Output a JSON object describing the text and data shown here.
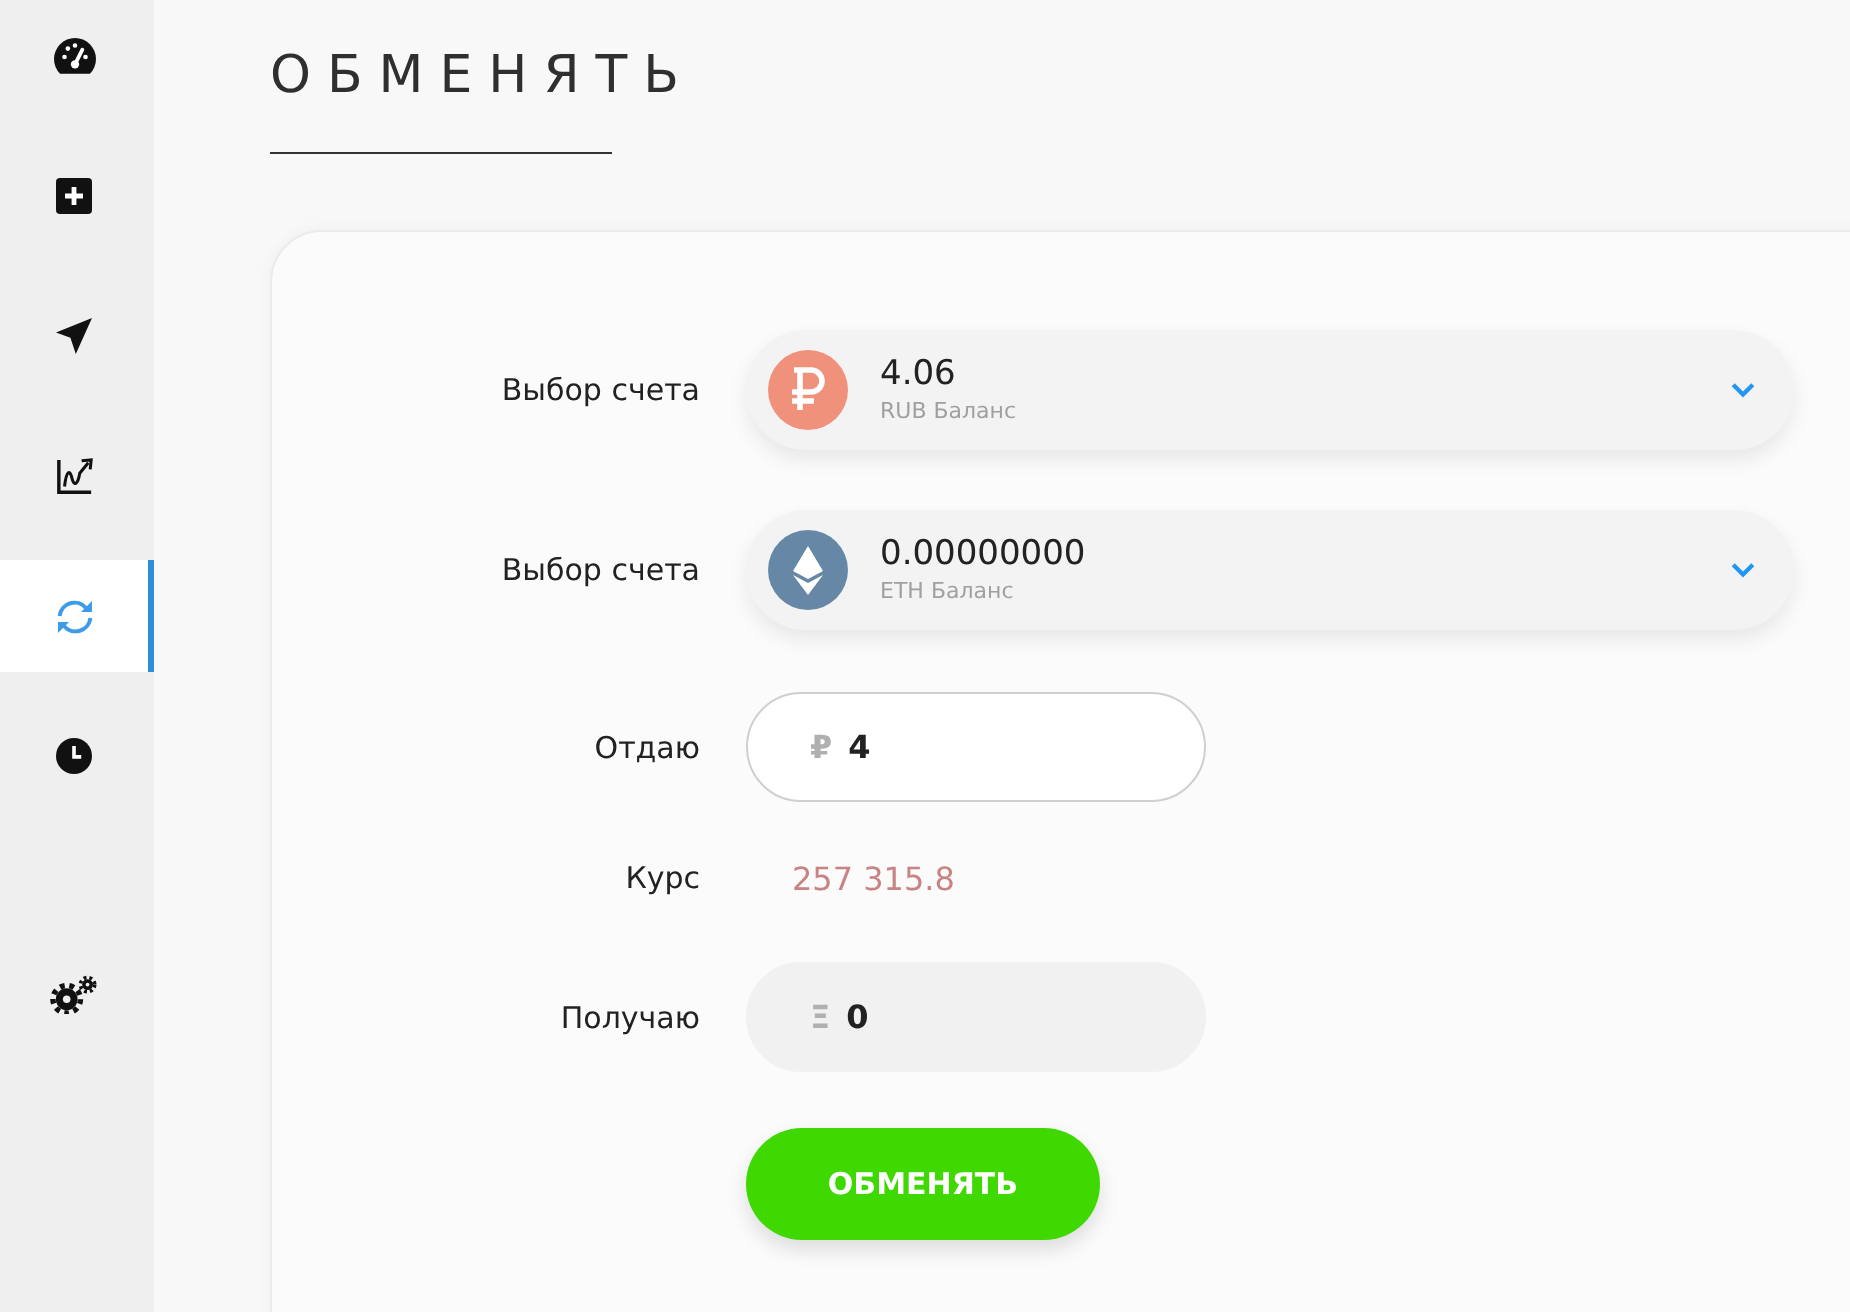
{
  "sidebar": {
    "items": [
      {
        "selected": false
      },
      {
        "selected": false
      },
      {
        "selected": false
      },
      {
        "selected": false
      },
      {
        "selected": true
      },
      {
        "selected": false
      }
    ],
    "bottom_items": [
      {
        "selected": false
      }
    ]
  },
  "page": {
    "title": "ОБМЕНЯТЬ"
  },
  "form": {
    "accounts": [
      {
        "label": "Выбор счета",
        "amount": "4.06",
        "caption": "RUB Баланс"
      },
      {
        "label": "Выбор счета",
        "amount": "0.00000000",
        "caption": "ETH Баланс"
      }
    ],
    "give": {
      "label": "Отдаю",
      "symbol": "₽",
      "value": "4",
      "disabled": false
    },
    "rate": {
      "label": "Курс",
      "value": "257 315.8"
    },
    "receive": {
      "label": "Получаю",
      "symbol": "Ξ",
      "value": "0",
      "disabled": true
    },
    "submit": {
      "label": "ОБМЕНЯТЬ"
    }
  }
}
